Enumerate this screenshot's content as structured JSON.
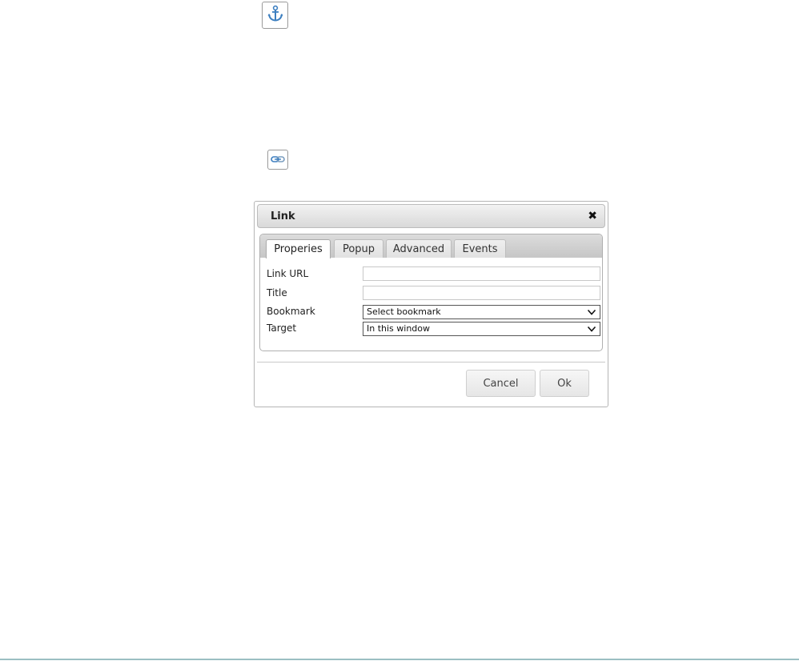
{
  "toolbar": {
    "anchor_icon": "anchor-icon",
    "link_icon": "link-icon"
  },
  "dialog": {
    "title": "Link",
    "close_glyph": "✖",
    "tabs": [
      {
        "label": "Properies",
        "active": true
      },
      {
        "label": "Popup",
        "active": false
      },
      {
        "label": "Advanced",
        "active": false
      },
      {
        "label": "Events",
        "active": false
      }
    ],
    "fields": {
      "link_url": {
        "label": "Link URL",
        "value": ""
      },
      "title": {
        "label": "Title",
        "value": ""
      },
      "bookmark": {
        "label": "Bookmark",
        "selected": "Select bookmark"
      },
      "target": {
        "label": "Target",
        "selected": "In this window"
      }
    },
    "buttons": {
      "cancel": "Cancel",
      "ok": "Ok"
    }
  },
  "colors": {
    "anchor_blue": "#3d7fc0",
    "bottom_rule": "#9bbfc2"
  }
}
